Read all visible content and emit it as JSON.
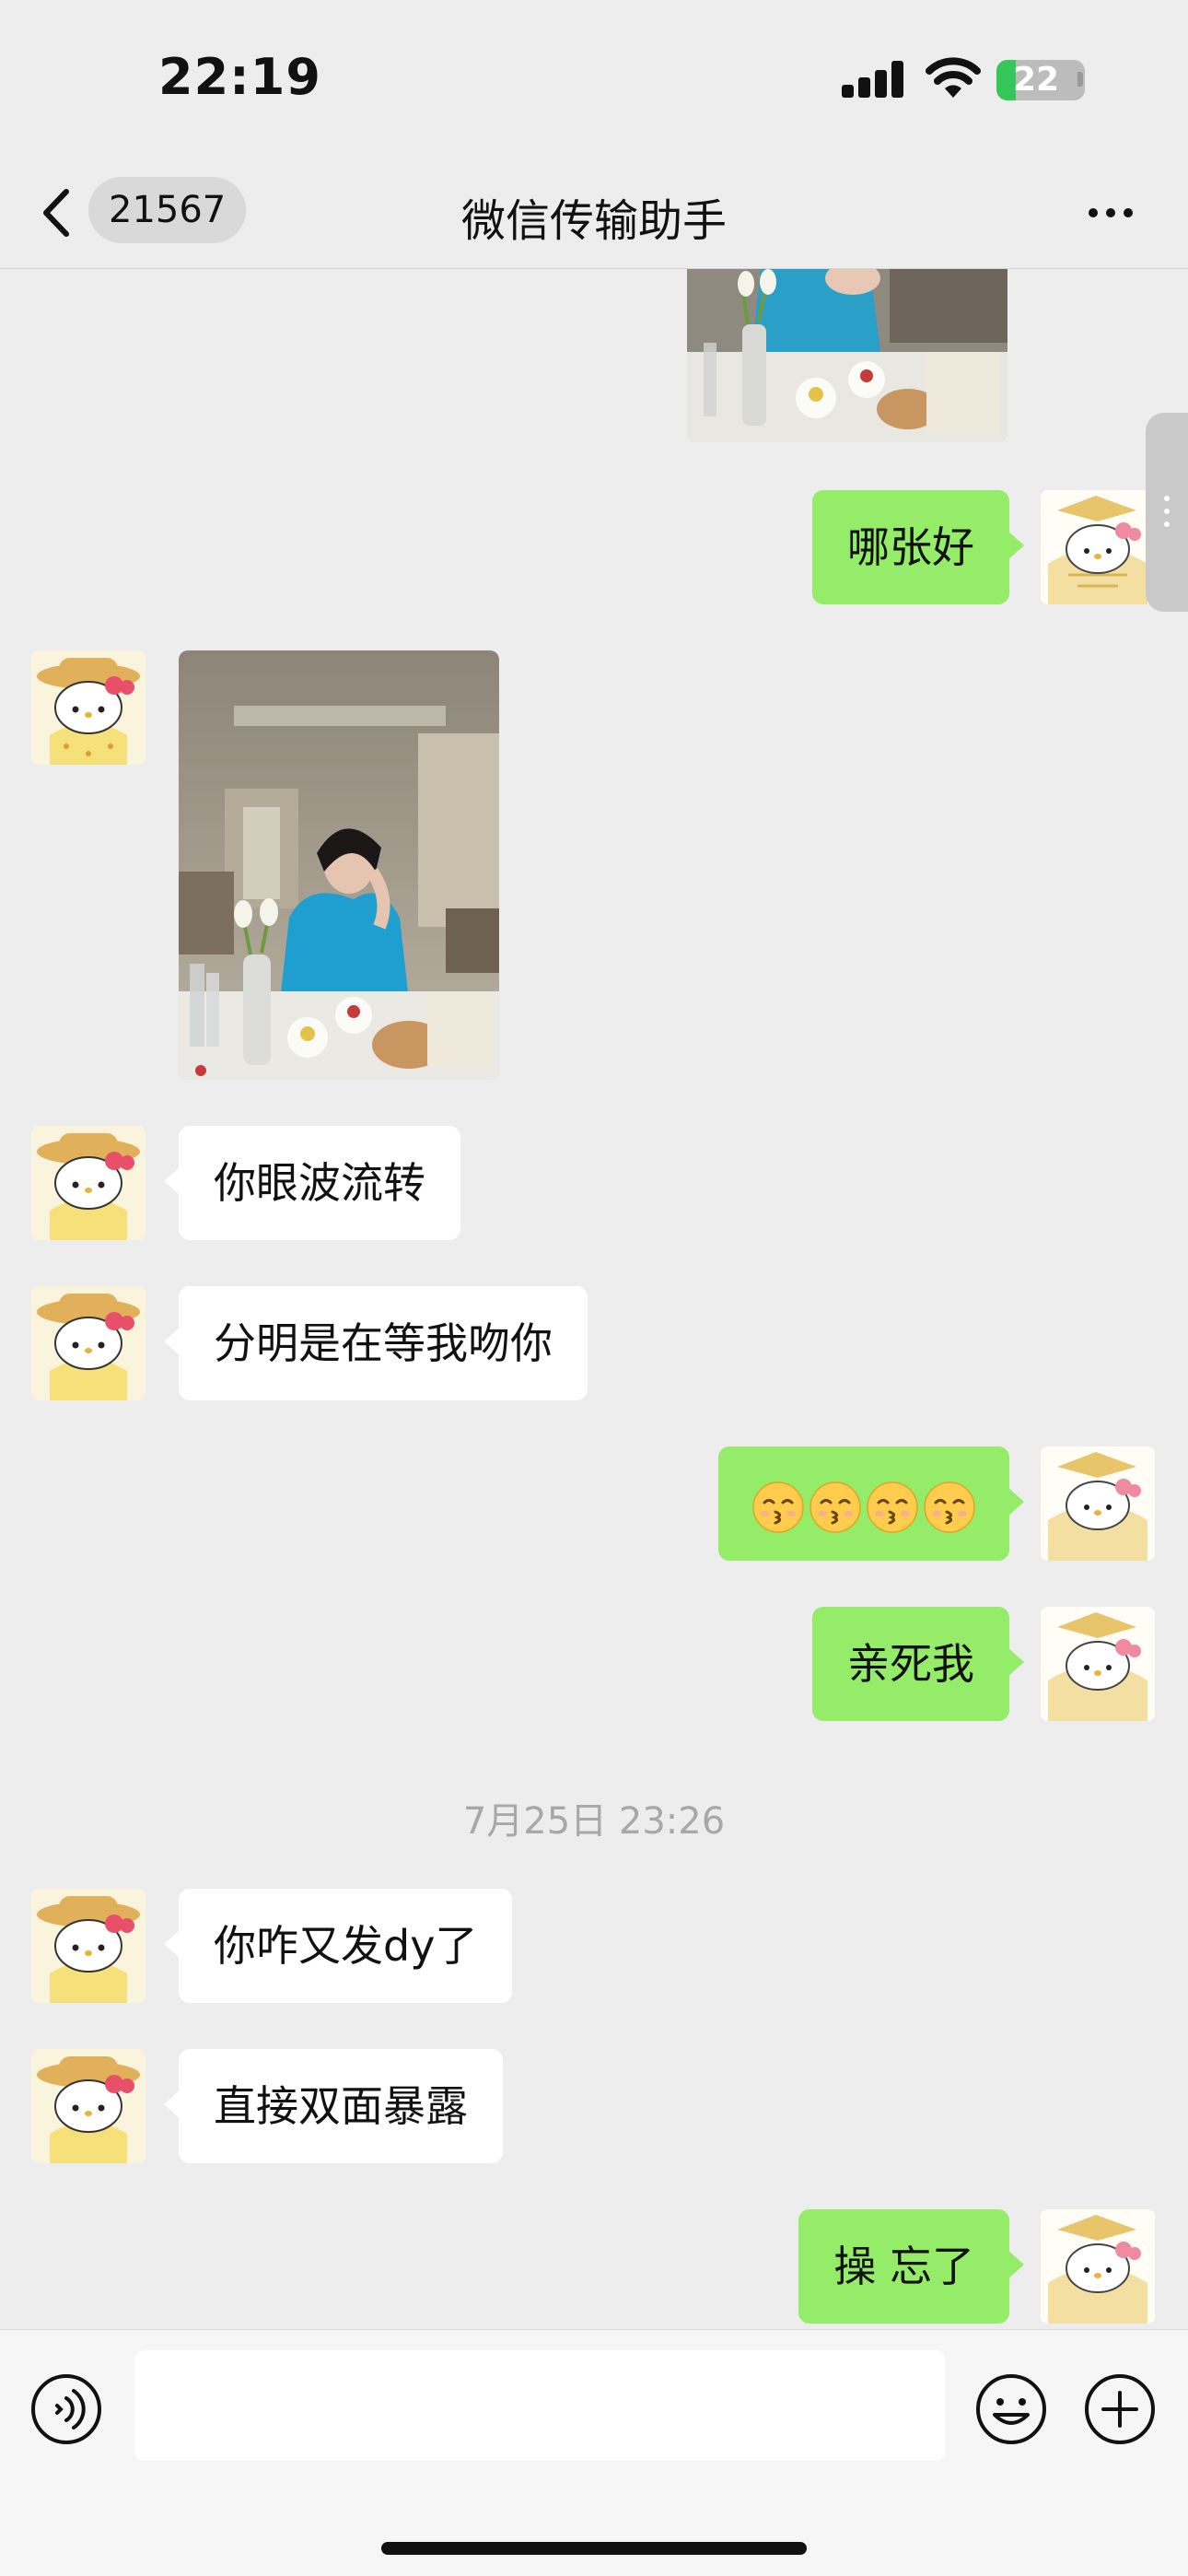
{
  "status_bar": {
    "time": "22:19",
    "battery_level": "22",
    "battery_fraction": 0.22,
    "charging": true,
    "signal_bars": 4,
    "colors": {
      "battery_fill": "#35c759",
      "battery_empty": "#bcbcbc"
    }
  },
  "nav": {
    "back_icon": "chevron-left-icon",
    "unread_count": "21567",
    "title": "微信传输助手",
    "more_icon": "ellipsis-icon"
  },
  "chat": {
    "colors": {
      "background": "#ededed",
      "incoming_bubble": "#ffffff",
      "outgoing_bubble": "#95ec69"
    },
    "messages": [
      {
        "id": "m0",
        "sender": "me",
        "type": "image",
        "description": "photo (partially scrolled out)"
      },
      {
        "id": "m1",
        "sender": "me",
        "type": "text",
        "text": "哪张好"
      },
      {
        "id": "m2",
        "sender": "other",
        "type": "image"
      },
      {
        "id": "m3",
        "sender": "other",
        "type": "text",
        "text": "你眼波流转"
      },
      {
        "id": "m4",
        "sender": "other",
        "type": "text",
        "text": "分明是在等我吻你"
      },
      {
        "id": "m5",
        "sender": "me",
        "type": "emoji",
        "text": "😚😚😚😚",
        "count": 4,
        "emoji_icon": "kissing-face-icon"
      },
      {
        "id": "m6",
        "sender": "me",
        "type": "text",
        "text": "亲死我"
      },
      {
        "id": "t1",
        "type": "timestamp",
        "text": "7月25日 23:26"
      },
      {
        "id": "m7",
        "sender": "other",
        "type": "text",
        "text": "你咋又发dy了"
      },
      {
        "id": "m8",
        "sender": "other",
        "type": "text",
        "text": "直接双面暴露"
      },
      {
        "id": "m9",
        "sender": "me",
        "type": "text",
        "text": "操 忘了"
      }
    ]
  },
  "input_bar": {
    "voice_icon": "voice-icon",
    "text_value": "",
    "emoji_icon": "smiley-icon",
    "add_icon": "plus-circle-icon"
  }
}
